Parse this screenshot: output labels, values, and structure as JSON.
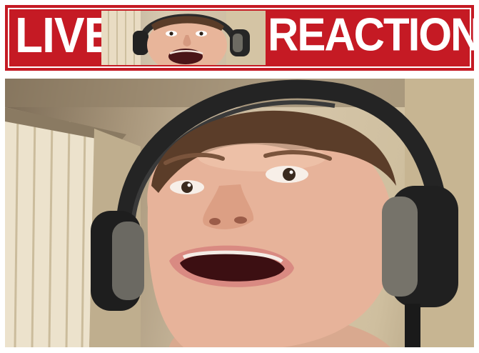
{
  "banner": {
    "left_word": "LIVE",
    "right_word": "REACTION",
    "background_color": "#c51a24",
    "text_color": "#ffffff"
  },
  "thumbnail": {
    "icon": "screaming-face-thumbnail"
  },
  "photo": {
    "icon": "screaming-person-with-headset"
  }
}
